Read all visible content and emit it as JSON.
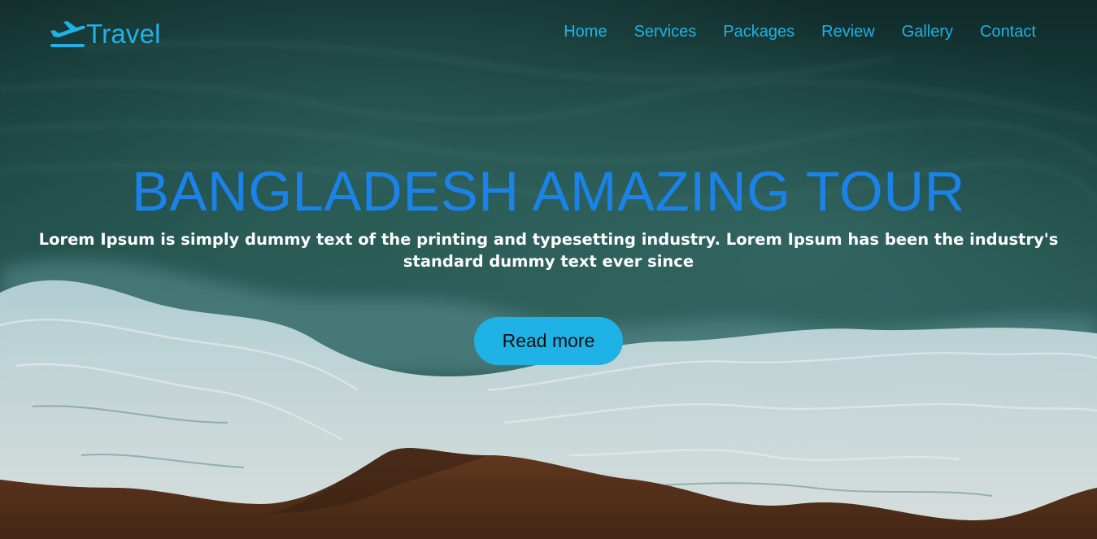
{
  "brand": {
    "name": "Travel",
    "icon": "airplane-icon",
    "color": "#1fb2e6"
  },
  "nav": {
    "items": [
      {
        "label": "Home"
      },
      {
        "label": "Services"
      },
      {
        "label": "Packages"
      },
      {
        "label": "Review"
      },
      {
        "label": "Gallery"
      },
      {
        "label": "Contact"
      }
    ]
  },
  "hero": {
    "title": "BANGLADESH AMAZING TOUR",
    "subtitle": "Lorem Ipsum is simply dummy text of the printing and typesetting industry. Lorem Ipsum has been the industry's standard dummy text ever since",
    "button_label": "Read more",
    "title_color": "#1a82e8",
    "button_color": "#1fb2e6",
    "background": "aerial-ocean-waves-beach-photo"
  }
}
